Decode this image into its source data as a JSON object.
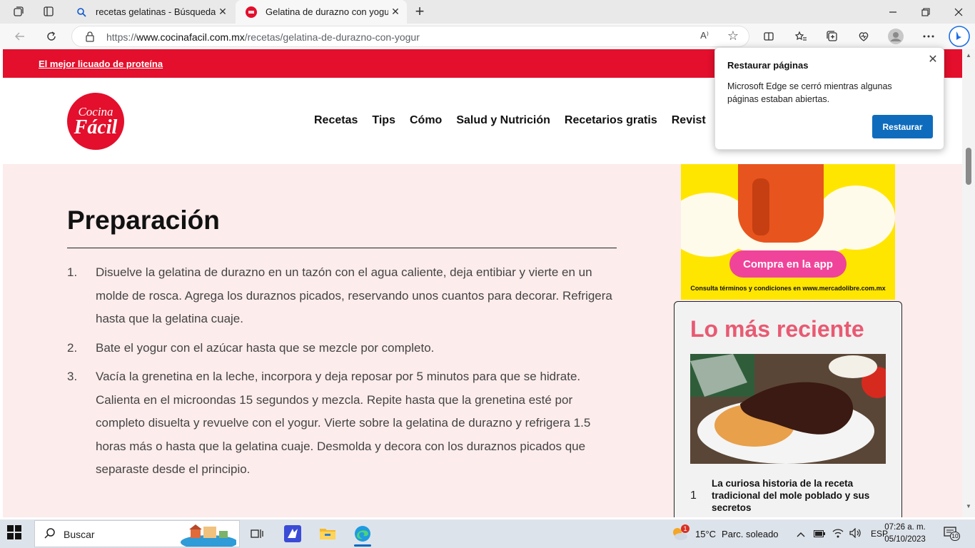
{
  "browser": {
    "tabs": [
      {
        "title": "recetas gelatinas - Búsqueda",
        "active": false
      },
      {
        "title": "Gelatina de durazno con yogur",
        "active": true
      }
    ],
    "url_prefix": "https://",
    "url_host": "www.cocinafacil.com.mx",
    "url_path": "/recetas/gelatina-de-durazno-con-yogur",
    "read_aloud": "A⁾"
  },
  "site": {
    "promo_link": "El mejor licuado de proteína",
    "logo_line1": "Cocina",
    "logo_line2": "Fácil",
    "nav": [
      "Recetas",
      "Tips",
      "Cómo",
      "Salud y Nutrición",
      "Recetarios gratis",
      "Revist"
    ]
  },
  "article": {
    "heading": "Preparación",
    "steps": [
      {
        "num": "1.",
        "text": "Disuelve la gelatina de durazno en un tazón con el agua caliente, deja entibiar y vierte en un molde de rosca. Agrega los duraznos picados, reservando unos cuantos para decorar. Refrigera hasta que la gelatina cuaje."
      },
      {
        "num": "2.",
        "text": "Bate el yogur con el azúcar hasta que se mezcle por completo."
      },
      {
        "num": "3.",
        "text": "Vacía la grenetina en la leche, incorpora y deja reposar por 5 minutos para que se hidrate. Calienta en el microondas 15 segundos y mezcla. Repite hasta que la grenetina esté por completo disuelta y revuelve con el yogur. Vierte sobre la gelatina de durazno y refrigera 1.5 horas más o hasta que la gelatina cuaje. Desmolda y decora con los duraznos picados que separaste desde el principio."
      }
    ]
  },
  "ad": {
    "cta": "Compra en la app",
    "terms": "Consulta términos y condiciones en www.mercadolibre.com.mx"
  },
  "recent": {
    "heading": "Lo más reciente",
    "items": [
      {
        "num": "1",
        "title": "La curiosa historia de la receta tradicional del mole poblado y sus secretos"
      }
    ]
  },
  "popup": {
    "title": "Restaurar páginas",
    "message": "Microsoft Edge se cerró mientras algunas páginas estaban abiertas.",
    "button": "Restaurar"
  },
  "taskbar": {
    "search_placeholder": "Buscar",
    "weather_temp": "15°C",
    "weather_desc": "Parc. soleado",
    "weather_badge": "1",
    "language": "ESP",
    "time": "07:26 a. m.",
    "date": "05/10/2023",
    "notification_count": "10"
  },
  "colors": {
    "brand_red": "#e30f2c",
    "page_bg": "#fdecec",
    "recent_heading": "#e85a72",
    "cta_pink": "#f0449a",
    "edge_blue": "#0f6cbd"
  }
}
